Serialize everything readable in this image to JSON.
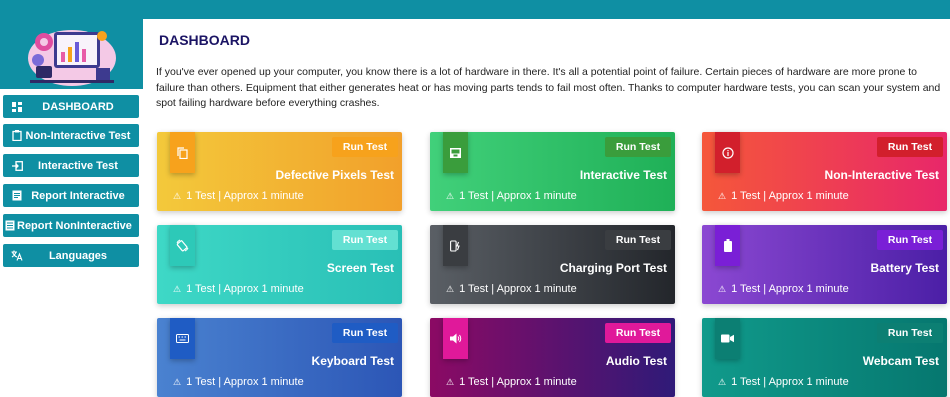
{
  "sidebar": {
    "logo": "computer-hardware-illustration",
    "items": [
      {
        "label": "DASHBOARD",
        "icon": "dashboard-grid-icon"
      },
      {
        "label": "Non-Interactive Test",
        "icon": "clipboard-icon"
      },
      {
        "label": "Interactive Test",
        "icon": "login-icon"
      },
      {
        "label": "Report Interactive",
        "icon": "report-icon"
      },
      {
        "label": "Report NonInteractive",
        "icon": "list-report-icon"
      },
      {
        "label": "Languages",
        "icon": "translate-icon"
      }
    ]
  },
  "main": {
    "title": "DASHBOARD",
    "description": "If you've ever opened up your computer, you know there is a lot of hardware in there. It's all a potential point of failure. Certain pieces of hardware are more prone to failure than others. Equipment that either generates heat or has moving parts tends to fail most often. Thanks to computer hardware tests, you can scan your system and spot failing hardware before everything crashes."
  },
  "cards": [
    {
      "name": "Defective Pixels Test",
      "run": "Run Test",
      "meta": "1 Test | Approx 1 minute",
      "icon": "copy-icon",
      "accent": "#f7a21c"
    },
    {
      "name": "Interactive Test",
      "run": "Run Test",
      "meta": "1 Test | Approx 1 minute",
      "icon": "inbox-icon",
      "accent": "#3a9d3c"
    },
    {
      "name": "Non-Interactive Test",
      "run": "Run Test",
      "meta": "1 Test | Approx 1 minute",
      "icon": "info-icon",
      "accent": "#d21f2c"
    },
    {
      "name": "Screen Test",
      "run": "Run Test",
      "meta": "1 Test | Approx 1 minute",
      "icon": "screen-rotation-icon",
      "accent": "#63e0d2"
    },
    {
      "name": "Charging Port Test",
      "run": "Run Test",
      "meta": "1 Test | Approx 1 minute",
      "icon": "charging-icon",
      "accent": "#3a3d41"
    },
    {
      "name": "Battery Test",
      "run": "Run Test",
      "meta": "1 Test | Approx 1 minute",
      "icon": "battery-icon",
      "accent": "#7a1fd6"
    },
    {
      "name": "Keyboard Test",
      "run": "Run Test",
      "meta": "1 Test | Approx 1 minute",
      "icon": "keyboard-icon",
      "accent": "#1f5cc4"
    },
    {
      "name": "Audio Test",
      "run": "Run Test",
      "meta": "1 Test | Approx 1 minute",
      "icon": "speaker-icon",
      "accent": "#e0199a"
    },
    {
      "name": "Webcam Test",
      "run": "Run Test",
      "meta": "1 Test | Approx 1 minute",
      "icon": "video-camera-icon",
      "accent": "#0c7f73"
    }
  ]
}
